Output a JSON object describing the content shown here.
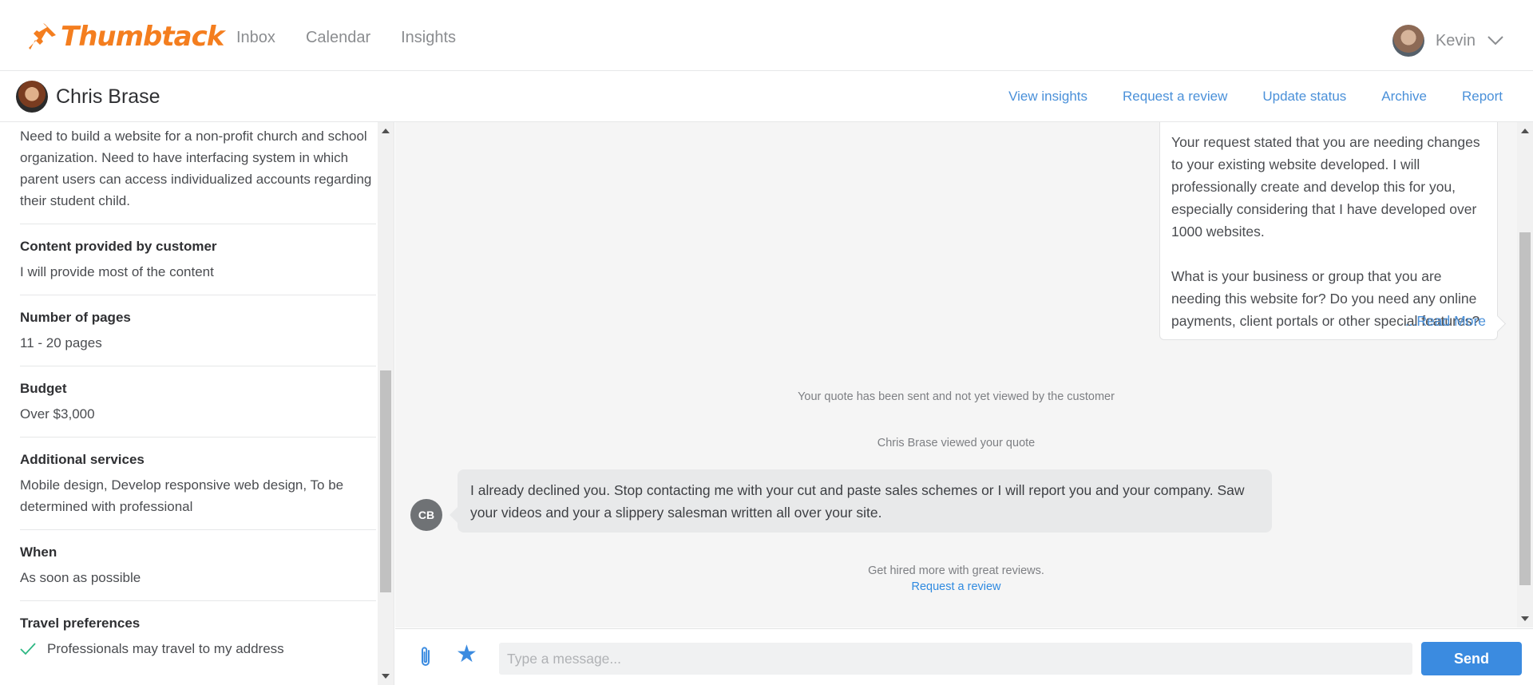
{
  "app": {
    "brand": "Thumbtack",
    "brand_color": "#f47e1f",
    "accent_color": "#3b8be0"
  },
  "topnav": {
    "links": [
      {
        "label": "Inbox"
      },
      {
        "label": "Calendar"
      },
      {
        "label": "Insights"
      }
    ],
    "user": {
      "name": "Kevin"
    }
  },
  "thread": {
    "customer_name": "Chris Brase",
    "actions": [
      {
        "label": "View insights"
      },
      {
        "label": "Request a review"
      },
      {
        "label": "Update status"
      },
      {
        "label": "Archive"
      },
      {
        "label": "Report"
      }
    ]
  },
  "details": {
    "description": "Need to build a website for a non-profit church and school organization. Need to have interfacing system in which parent users can access individualized accounts regarding their student child.",
    "fields": [
      {
        "label": "Content provided by customer",
        "value": "I will provide most of the content"
      },
      {
        "label": "Number of pages",
        "value": "11 - 20 pages"
      },
      {
        "label": "Budget",
        "value": "Over $3,000"
      },
      {
        "label": "Additional services",
        "value": "Mobile design, Develop responsive web design, To be determined with professional"
      },
      {
        "label": "When",
        "value": "As soon as possible"
      }
    ],
    "travel": {
      "label": "Travel preferences",
      "value": "Professionals may travel to my address"
    }
  },
  "messages": {
    "outgoing": {
      "para1": "Your request stated that you are needing changes to your existing website developed. I will professionally create and develop this for you, especially considering that I have developed over 1000 websites.",
      "para2": "What is your business or group that you are needing this website for? Do you need any online payments, client portals or other special features?",
      "read_more": "...Read More"
    },
    "system1": "Your quote has been sent and not yet viewed by the customer",
    "system2": "Chris Brase viewed your quote",
    "incoming": {
      "initials": "CB",
      "text": "I already declined you.  Stop contacting me with your cut and paste sales schemes or I will report you and your company. Saw your videos and your a slippery salesman written all over your site."
    },
    "review_prompt": "Get hired more with great reviews.",
    "review_link": "Request a review"
  },
  "compose": {
    "placeholder": "Type a message...",
    "send_label": "Send"
  }
}
